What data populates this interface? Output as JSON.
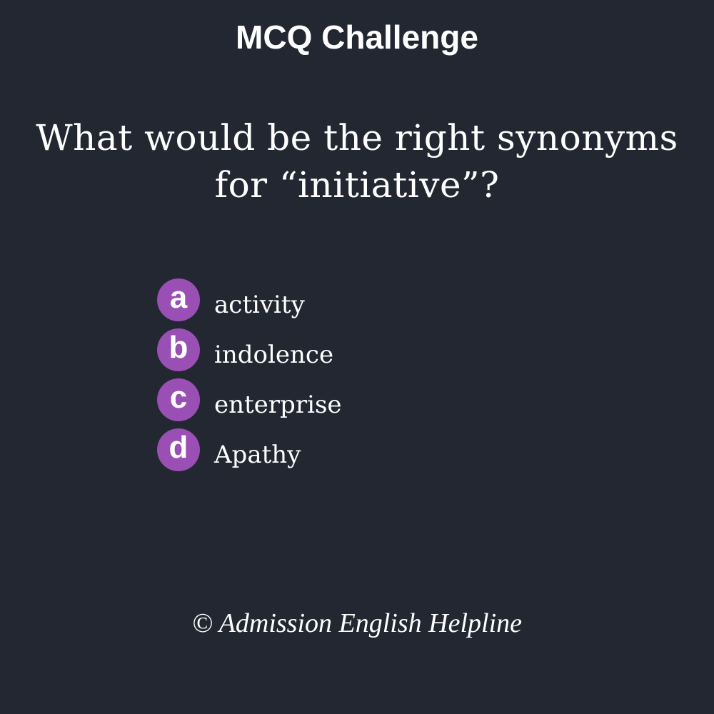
{
  "header": {
    "title": "MCQ Challenge"
  },
  "question": {
    "line1": "What would be the right synonyms",
    "line2": "for “initiative”?"
  },
  "options": [
    {
      "letter": "a",
      "text": "activity"
    },
    {
      "letter": "b",
      "text": "indolence"
    },
    {
      "letter": "c",
      "text": "enterprise"
    },
    {
      "letter": "d",
      "text": "Apathy"
    }
  ],
  "footer": {
    "copyright": "© Admission English Helpline"
  },
  "colors": {
    "background": "#222732",
    "badge": "#9a4fb4",
    "text": "#ffffff"
  }
}
